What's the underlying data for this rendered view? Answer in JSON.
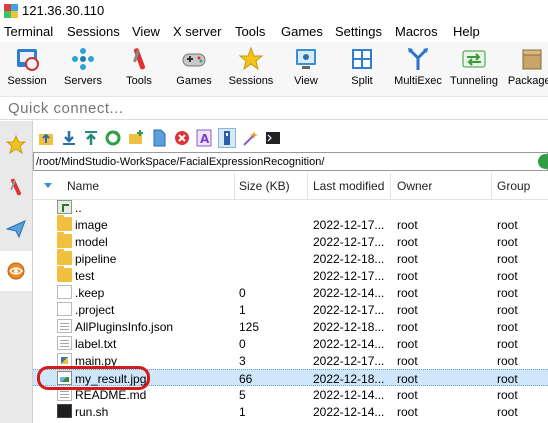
{
  "window": {
    "title": "121.36.30.110"
  },
  "menu": [
    "Terminal",
    "Sessions",
    "View",
    "X server",
    "Tools",
    "Games",
    "Settings",
    "Macros",
    "Help"
  ],
  "toolbar": [
    {
      "label": "Session",
      "icon": "session-icon"
    },
    {
      "label": "Servers",
      "icon": "servers-icon"
    },
    {
      "label": "Tools",
      "icon": "tools-icon"
    },
    {
      "label": "Games",
      "icon": "games-icon"
    },
    {
      "label": "Sessions",
      "icon": "sessions-star-icon"
    },
    {
      "label": "View",
      "icon": "view-icon"
    },
    {
      "label": "Split",
      "icon": "split-icon"
    },
    {
      "label": "MultiExec",
      "icon": "multiexec-icon"
    },
    {
      "label": "Tunneling",
      "icon": "tunneling-icon"
    },
    {
      "label": "Packages",
      "icon": "packages-icon"
    }
  ],
  "quick_connect": {
    "placeholder": "Quick connect..."
  },
  "sftp": {
    "path": "/root/MindStudio-WorkSpace/FacialExpressionRecognition/",
    "columns": [
      "Name",
      "Size (KB)",
      "Last modified",
      "Owner",
      "Group"
    ],
    "rows": [
      {
        "name": "..",
        "size": "",
        "modified": "",
        "owner": "",
        "group": "",
        "type": "parent"
      },
      {
        "name": "image",
        "size": "",
        "modified": "2022-12-17...",
        "owner": "root",
        "group": "root",
        "type": "folder"
      },
      {
        "name": "model",
        "size": "",
        "modified": "2022-12-17...",
        "owner": "root",
        "group": "root",
        "type": "folder"
      },
      {
        "name": "pipeline",
        "size": "",
        "modified": "2022-12-18...",
        "owner": "root",
        "group": "root",
        "type": "folder"
      },
      {
        "name": "test",
        "size": "",
        "modified": "2022-12-17...",
        "owner": "root",
        "group": "root",
        "type": "folder"
      },
      {
        "name": ".keep",
        "size": "0",
        "modified": "2022-12-14...",
        "owner": "root",
        "group": "root",
        "type": "file"
      },
      {
        "name": ".project",
        "size": "1",
        "modified": "2022-12-17...",
        "owner": "root",
        "group": "root",
        "type": "file"
      },
      {
        "name": "AllPluginsInfo.json",
        "size": "125",
        "modified": "2022-12-18...",
        "owner": "root",
        "group": "root",
        "type": "json"
      },
      {
        "name": "label.txt",
        "size": "0",
        "modified": "2022-12-14...",
        "owner": "root",
        "group": "root",
        "type": "json"
      },
      {
        "name": "main.py",
        "size": "3",
        "modified": "2022-12-17...",
        "owner": "root",
        "group": "root",
        "type": "py"
      },
      {
        "name": "my_result.jpg",
        "size": "66",
        "modified": "2022-12-18...",
        "owner": "root",
        "group": "root",
        "type": "img",
        "selected": true
      },
      {
        "name": "README.md",
        "size": "5",
        "modified": "2022-12-14...",
        "owner": "root",
        "group": "root",
        "type": "json"
      },
      {
        "name": "run.sh",
        "size": "1",
        "modified": "2022-12-14...",
        "owner": "root",
        "group": "root",
        "type": "term"
      }
    ]
  },
  "colors": {
    "selection": "#cfe6fb",
    "highlight_ring": "#d51a1a",
    "folder": "#f2c040"
  }
}
